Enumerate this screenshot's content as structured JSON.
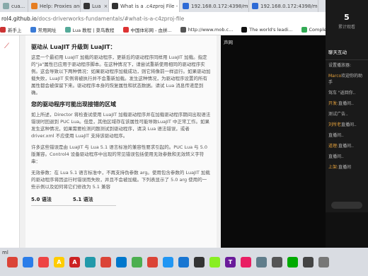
{
  "tabs": [
    {
      "title": "cua...",
      "color": "#8aa"
    },
    {
      "title": "Help: Proxies and Connecti",
      "color": "#e67e22"
    },
    {
      "title": "Lua",
      "color": "#333"
    },
    {
      "title": "What is a .c4zproj File - Dr",
      "color": "#333"
    },
    {
      "title": "192.168.0.172:4398/mobil",
      "color": "#2e6bd6"
    },
    {
      "title": "192.168.0.172:4398/mobil",
      "color": "#2e6bd6"
    }
  ],
  "address": {
    "host": "rol4.github.io",
    "path": "/docs-driverworks-fundamentals/#what-is-a-c4zproj-file"
  },
  "bookmarks": [
    {
      "label": "新手上",
      "color": "#c33"
    },
    {
      "label": "常用网址",
      "color": "#3b7bd6"
    },
    {
      "label": "Lua 教程 | 菜鸟教程",
      "color": "#5a9"
    },
    {
      "label": "中国体彩网 - 血拼...",
      "color": "#d33"
    },
    {
      "label": "http://www.mob.c...",
      "color": "#555"
    },
    {
      "label": "The world's leadi...",
      "color": "#111"
    },
    {
      "label": "Complete softw...",
      "color": "#3a5"
    }
  ],
  "doc": {
    "heading1": "驱动从 LuaJIT 升级到 LuaJIT：",
    "para1": "这是一个最初用 LuaJIT 加载的驱动程序，更新后的驱动程序同样用 LuaJIT 加载。指定的\"ja\"属性已应用于驱动程序脚本。在这种情况下，请尝试重新使用相同的驱动程序实例。这会导致以下两种情况：如果驱动程序加载成功，则它将像前一样运行。如果驱动加载失败，LuaJIT 实例将被执行并不会重新加载。发生这种情况，为驱动程序设置的所有属性都会被保留下来。驱动程序本身的恢复属性和状态数据。请试 Lua 消息传递是到确。",
    "heading2": "您的驱动程序可能出现接错的区域",
    "para2": "如上所述，Director 将检查试使用 LuaJIT 加载驱动程序并在加载驱动程序期间出现语法错误时回退到 PUC Lua。但是，其他区域存在该属性可能导致LuaJIT 中正常工作。如果发生这种情况，如果需要检测问题测试到驱动程序，请决 Lua 语法错误，或者 driver.xml 不应使用 LuaJIT 支持该驱动程序。",
    "para3": "许多这些错误是由 LuaJIT 与 Lua 5.1 语言标准的兼容性要求引起的。PUC Lua 与 5.0 版兼容。Control4 设备驱动程序中出现的常见错误包括使用无效参数和无效转义字符串：",
    "para4": "无效参数：在 Lua 5.1 语言标准中，不再支持伪参数 arg。使用包含参数的 LuaJIT 加载的驱动程序将因运行时错误而失败，并且不会被加载。下列表显示了 5.0 arg 使用的一些示例以及如何将它们修改为 5.1 兼容",
    "col1": "5.0 语法",
    "col2": "5.1 语法"
  },
  "video": {
    "label": "声网"
  },
  "live": {
    "count": "5",
    "count_label": "累计观看",
    "chat_title": "聊天互动",
    "messages": [
      {
        "nick": "",
        "text": "设置播放器:"
      },
      {
        "nick": "Marco",
        "text": "欢迎你的助手"
      },
      {
        "nick": "",
        "text": "驾车 \"返回你.."
      },
      {
        "nick": "开发:",
        "text": "直播间.."
      },
      {
        "nick": "",
        "text": "测试广告.."
      },
      {
        "nick": "刘所老",
        "text": "直播间.."
      },
      {
        "nick": "",
        "text": "直播间.."
      },
      {
        "nick": "道理:",
        "text": "直播间.."
      },
      {
        "nick": "",
        "text": "直播间.."
      },
      {
        "nick": "上架:",
        "text": "直播间"
      }
    ]
  },
  "taskbar": {
    "side_label": "ml",
    "icons": [
      {
        "name": "chrome",
        "color": "#db4437",
        "glyph": ""
      },
      {
        "name": "app2",
        "color": "#2b7de9",
        "glyph": ""
      },
      {
        "name": "app3",
        "color": "#e44",
        "glyph": ""
      },
      {
        "name": "app4",
        "color": "#fc0",
        "glyph": "A"
      },
      {
        "name": "app5",
        "color": "#c22",
        "glyph": "A"
      },
      {
        "name": "app6",
        "color": "#29a",
        "glyph": ""
      },
      {
        "name": "app7",
        "color": "#db4437",
        "glyph": ""
      },
      {
        "name": "app8",
        "color": "#07c",
        "glyph": ""
      },
      {
        "name": "app9",
        "color": "#4caf50",
        "glyph": ""
      },
      {
        "name": "app10",
        "color": "#db4437",
        "glyph": ""
      },
      {
        "name": "app11",
        "color": "#2196f3",
        "glyph": ""
      },
      {
        "name": "app12",
        "color": "#1976d2",
        "glyph": ""
      },
      {
        "name": "app13",
        "color": "#333",
        "glyph": ""
      },
      {
        "name": "app14",
        "color": "#8e2",
        "glyph": ""
      },
      {
        "name": "app15",
        "color": "#6a1b9a",
        "glyph": "T"
      },
      {
        "name": "app16",
        "color": "#e91e63",
        "glyph": ""
      },
      {
        "name": "app17",
        "color": "#607d8b",
        "glyph": ""
      },
      {
        "name": "app18",
        "color": "#555",
        "glyph": ""
      },
      {
        "name": "app19",
        "color": "#0a0",
        "glyph": ""
      },
      {
        "name": "app20",
        "color": "#444",
        "glyph": ""
      },
      {
        "name": "app21",
        "color": "#777",
        "glyph": ""
      }
    ]
  }
}
